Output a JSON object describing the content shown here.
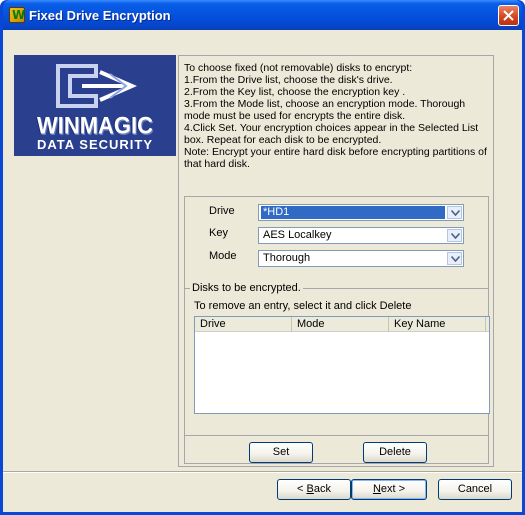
{
  "window": {
    "title": "Fixed Drive Encryption",
    "icon": "winmagic-app-icon"
  },
  "logo": {
    "line1": "WINMAGIC",
    "line2": "DATA SECURITY",
    "colors": {
      "background": "#2a3f8e",
      "text": "#ffffff"
    }
  },
  "instructions": [
    "To choose fixed (not removable) disks to encrypt:",
    "1.From the Drive list, choose the disk's drive.",
    "2.From the Key list, choose the encryption key .",
    "3.From the Mode list, choose an encryption mode. Thorough mode must be used for encrypts the entire disk.",
    "4.Click Set. Your encryption choices appear in the Selected List box.   Repeat for each disk to be encrypted.",
    "Note: Encrypt your entire hard disk before encrypting partitions of that hard disk."
  ],
  "form": {
    "drive": {
      "label": "Drive",
      "value": "*HD1"
    },
    "key": {
      "label": "Key",
      "value": "AES  Localkey"
    },
    "mode": {
      "label": "Mode",
      "value": "Thorough"
    }
  },
  "disks": {
    "group_label": "Disks to be encrypted.",
    "hint": "To remove an entry, select it and click Delete",
    "columns": [
      "Drive",
      "Mode",
      "Key Name"
    ],
    "rows": []
  },
  "buttons": {
    "set": "Set",
    "delete": "Delete",
    "back_prefix": "< ",
    "back_accel": "B",
    "back_rest": "ack",
    "next_accel": "N",
    "next_rest": "ext >",
    "cancel": "Cancel"
  },
  "colors": {
    "titlebar": "#0553df",
    "selection": "#316ac5",
    "dialog_bg": "#ece9d8"
  }
}
